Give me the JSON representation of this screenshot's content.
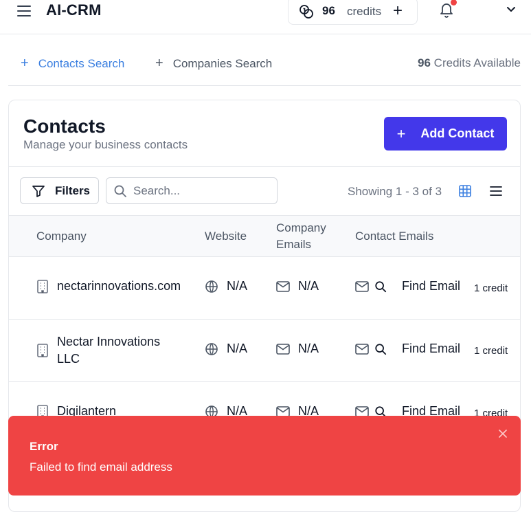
{
  "app": {
    "title": "AI-CRM"
  },
  "header": {
    "credits_count": "96",
    "credits_label": "credits",
    "plus": "+"
  },
  "tabs": [
    {
      "label": "Contacts Search",
      "active": true
    },
    {
      "label": "Companies Search",
      "active": false
    }
  ],
  "credits_available": {
    "count": "96",
    "label": "Credits Available"
  },
  "card": {
    "title": "Contacts",
    "subtitle": "Manage your business contacts",
    "add_label": "Add Contact"
  },
  "toolbar": {
    "filters_label": "Filters",
    "search_placeholder": "Search...",
    "showing": "Showing 1 - 3 of 3"
  },
  "table": {
    "headers": [
      "Company",
      "Website",
      "Company Emails",
      "Contact Emails"
    ],
    "rows": [
      {
        "company": "nectarinnovations.com",
        "website": "N/A",
        "company_email": "N/A",
        "action": "Find Email",
        "cost": "1 credit"
      },
      {
        "company": "Nectar Innovations LLC",
        "website": "N/A",
        "company_email": "N/A",
        "action": "Find Email",
        "cost": "1 credit"
      },
      {
        "company": "Digilantern",
        "website": "N/A",
        "company_email": "N/A",
        "action": "Find Email",
        "cost": "1 credit"
      }
    ]
  },
  "toast": {
    "title": "Error",
    "message": "Failed to find email address"
  },
  "colors": {
    "accent": "#4338ea",
    "link": "#3b7fe0",
    "error": "#ef4444"
  },
  "icons": [
    "menu-icon",
    "coins-icon",
    "plus-icon",
    "bell-icon",
    "chevron-down-icon",
    "filter-icon",
    "search-icon",
    "grid-icon",
    "list-icon",
    "building-icon",
    "globe-icon",
    "mail-icon",
    "close-icon"
  ]
}
